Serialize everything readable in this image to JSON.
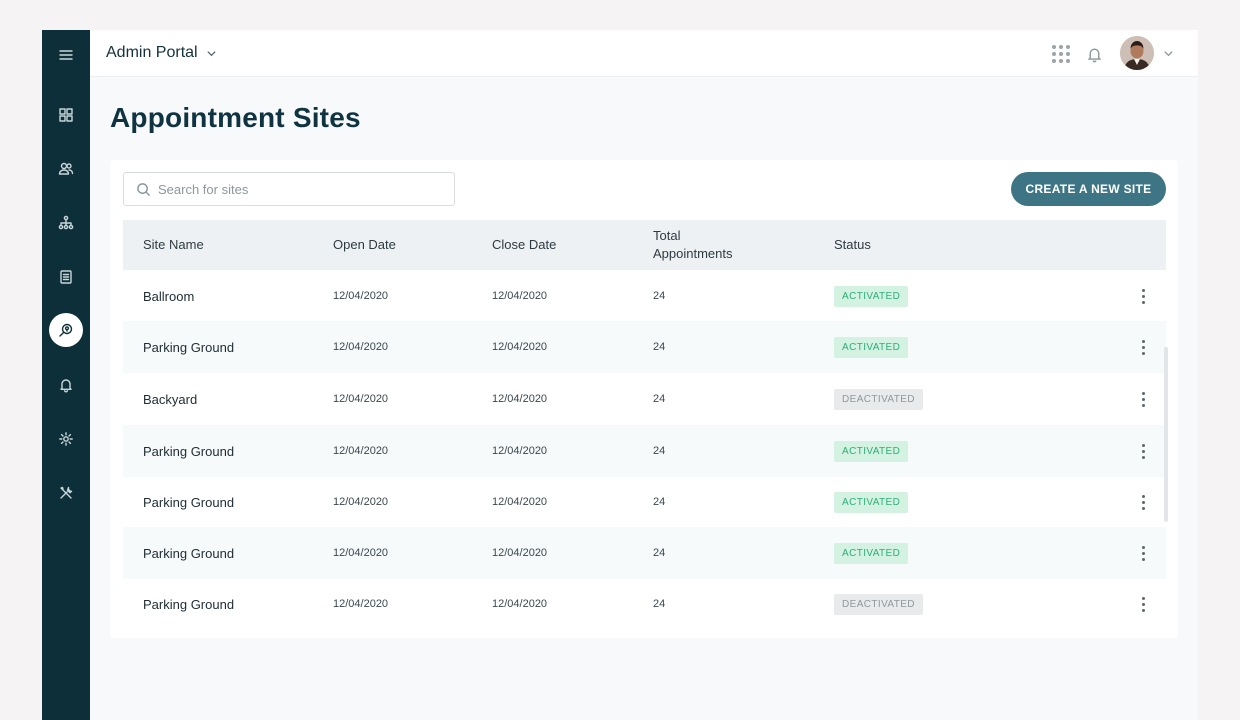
{
  "app": {
    "portal_title": "Admin Portal"
  },
  "sidebar": {
    "items": [
      {
        "icon": "menu-icon"
      },
      {
        "icon": "dashboard-icon"
      },
      {
        "icon": "users-icon"
      },
      {
        "icon": "org-chart-icon"
      },
      {
        "icon": "document-icon"
      },
      {
        "icon": "location-search-icon",
        "active": true
      },
      {
        "icon": "bell-icon"
      },
      {
        "icon": "settings-icon"
      },
      {
        "icon": "tools-icon"
      }
    ]
  },
  "page": {
    "title": "Appointment Sites"
  },
  "search": {
    "placeholder": "Search for sites",
    "value": ""
  },
  "actions": {
    "create_label": "CREATE A NEW SITE"
  },
  "table": {
    "headers": {
      "site_name": "Site Name",
      "open_date": "Open Date",
      "close_date": "Close Date",
      "total_line1": "Total",
      "total_line2": "Appointments",
      "status": "Status"
    },
    "rows": [
      {
        "name": "Ballroom",
        "open": "12/04/2020",
        "close": "12/04/2020",
        "total": "24",
        "status": "ACTIVATED",
        "active": true
      },
      {
        "name": "Parking Ground",
        "open": "12/04/2020",
        "close": "12/04/2020",
        "total": "24",
        "status": "ACTIVATED",
        "active": true
      },
      {
        "name": "Backyard",
        "open": "12/04/2020",
        "close": "12/04/2020",
        "total": "24",
        "status": "DEACTIVATED",
        "active": false
      },
      {
        "name": "Parking Ground",
        "open": "12/04/2020",
        "close": "12/04/2020",
        "total": "24",
        "status": "ACTIVATED",
        "active": true
      },
      {
        "name": "Parking Ground",
        "open": "12/04/2020",
        "close": "12/04/2020",
        "total": "24",
        "status": "ACTIVATED",
        "active": true
      },
      {
        "name": "Parking Ground",
        "open": "12/04/2020",
        "close": "12/04/2020",
        "total": "24",
        "status": "ACTIVATED",
        "active": true
      },
      {
        "name": "Parking Ground",
        "open": "12/04/2020",
        "close": "12/04/2020",
        "total": "24",
        "status": "DEACTIVATED",
        "active": false
      }
    ]
  },
  "colors": {
    "sidebar": "#0d2f3a",
    "accent": "#3e7585",
    "activated_bg": "#d4f2e2",
    "activated_text": "#2fae78",
    "deactivated_bg": "#e8eaeb",
    "deactivated_text": "#8f989c"
  }
}
